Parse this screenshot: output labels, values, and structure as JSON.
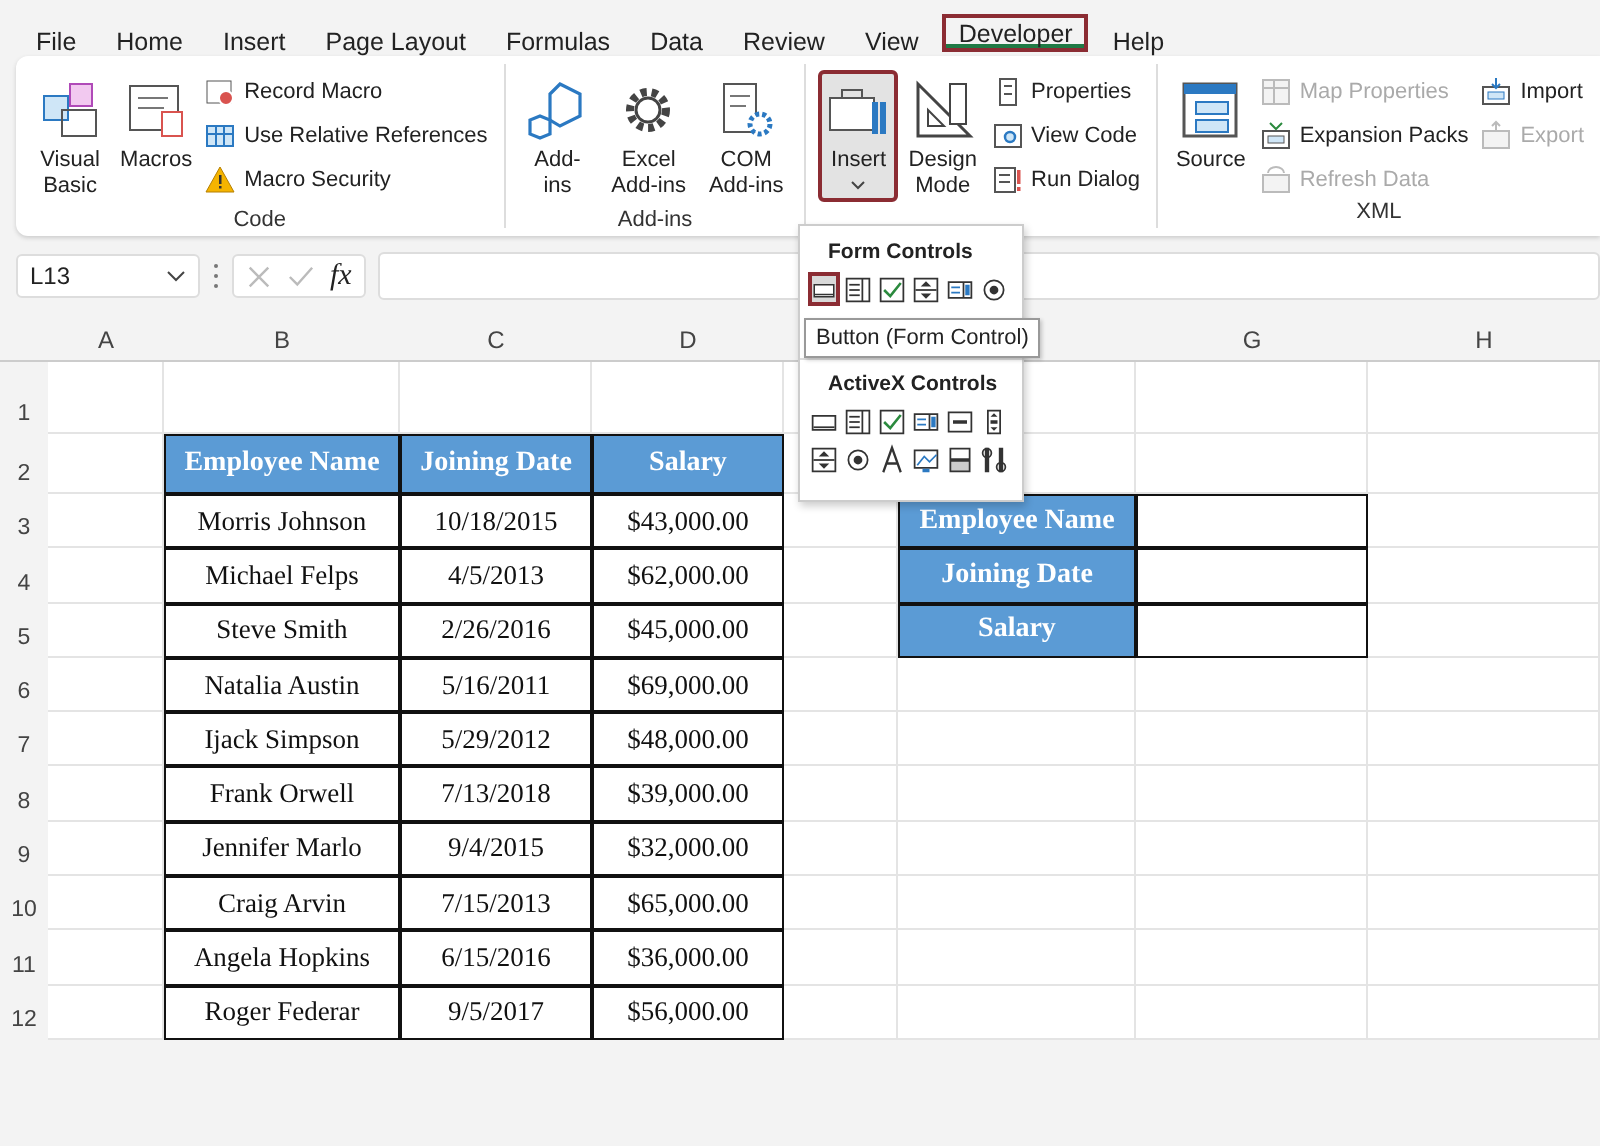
{
  "menu_tabs": [
    {
      "label": "File",
      "selected": false
    },
    {
      "label": "Home",
      "selected": false
    },
    {
      "label": "Insert",
      "selected": false
    },
    {
      "label": "Page Layout",
      "selected": false
    },
    {
      "label": "Formulas",
      "selected": false
    },
    {
      "label": "Data",
      "selected": false
    },
    {
      "label": "Review",
      "selected": false
    },
    {
      "label": "View",
      "selected": false
    },
    {
      "label": "Developer",
      "selected": true
    },
    {
      "label": "Help",
      "selected": false
    }
  ],
  "ribbon_groups": [
    {
      "label": "Code",
      "columns": [
        {
          "kind": "large",
          "label": "Visual Basic",
          "pressed": false
        },
        {
          "kind": "large",
          "label": "Macros",
          "pressed": false
        },
        {
          "kind": "stack",
          "items": [
            {
              "label": "Record Macro",
              "disabled": false
            },
            {
              "label": "Use Relative References",
              "disabled": false
            },
            {
              "label": "Macro Security",
              "disabled": false
            }
          ]
        }
      ]
    },
    {
      "label": "Add-ins",
      "columns": [
        {
          "kind": "large",
          "label": "Add-ins",
          "pressed": false
        },
        {
          "kind": "large",
          "label": "Excel Add-ins",
          "pressed": false
        },
        {
          "kind": "large",
          "label": "COM Add-ins",
          "pressed": false
        }
      ]
    },
    {
      "columns": [
        {
          "kind": "large",
          "label": "Insert",
          "pressed": true,
          "caret": true
        },
        {
          "kind": "large",
          "label": "Design Mode",
          "pressed": false
        },
        {
          "kind": "stack",
          "items": [
            {
              "label": "Properties",
              "disabled": false
            },
            {
              "label": "View Code",
              "disabled": false
            },
            {
              "label": "Run Dialog",
              "disabled": false
            }
          ]
        }
      ]
    },
    {
      "label": "XML",
      "columns": [
        {
          "kind": "large",
          "label": "Source",
          "pressed": false
        },
        {
          "kind": "stack",
          "items": [
            {
              "label": "Map Properties",
              "disabled": true
            },
            {
              "label": "Expansion Packs",
              "disabled": false
            },
            {
              "label": "Refresh Data",
              "disabled": true
            }
          ]
        },
        {
          "kind": "stack",
          "items": [
            {
              "label": "Import",
              "disabled": false
            },
            {
              "label": "Export",
              "disabled": true
            }
          ]
        }
      ]
    }
  ],
  "formula_bar": {
    "name_box": "L13",
    "fx": "fx"
  },
  "insert_menu": {
    "sections": [
      {
        "title": "Form Controls",
        "controls": [
          {
            "selected": true
          },
          {
            "selected": false
          },
          {
            "selected": false
          },
          {
            "selected": false
          },
          {
            "selected": false
          },
          {
            "selected": false
          }
        ]
      },
      {
        "title": "ActiveX Controls",
        "controls": [
          {
            "selected": false
          },
          {
            "selected": false
          },
          {
            "selected": false
          },
          {
            "selected": false
          },
          {
            "selected": false
          },
          {
            "selected": false
          },
          {
            "selected": false
          },
          {
            "selected": false
          },
          {
            "selected": false
          },
          {
            "selected": false
          },
          {
            "selected": false
          },
          {
            "selected": false
          }
        ]
      }
    ],
    "tooltip": "Button (Form Control)"
  },
  "column_headers": [
    "A",
    "B",
    "C",
    "D",
    "G",
    "H"
  ],
  "row_headers": [
    "1",
    "2",
    "3",
    "4",
    "5",
    "6",
    "7",
    "8",
    "9",
    "10",
    "11",
    "12"
  ],
  "employee_table": {
    "columns": [
      "Employee Name",
      "Joining Date",
      "Salary"
    ],
    "rows": [
      [
        "Morris Johnson",
        "10/18/2015",
        "$43,000.00"
      ],
      [
        "Michael Felps",
        "4/5/2013",
        "$62,000.00"
      ],
      [
        "Steve Smith",
        "2/26/2016",
        "$45,000.00"
      ],
      [
        "Natalia Austin",
        "5/16/2011",
        "$69,000.00"
      ],
      [
        "Ijack Simpson",
        "5/29/2012",
        "$48,000.00"
      ],
      [
        "Frank Orwell",
        "7/13/2018",
        "$39,000.00"
      ],
      [
        "Jennifer Marlo",
        "9/4/2015",
        "$32,000.00"
      ],
      [
        "Craig Arvin",
        "7/15/2013",
        "$65,000.00"
      ],
      [
        "Angela Hopkins",
        "6/15/2016",
        "$36,000.00"
      ],
      [
        "Roger Federar",
        "9/5/2017",
        "$56,000.00"
      ]
    ]
  },
  "lookup_table": {
    "labels": [
      "Employee Name",
      "Joining Date",
      "Salary"
    ]
  }
}
